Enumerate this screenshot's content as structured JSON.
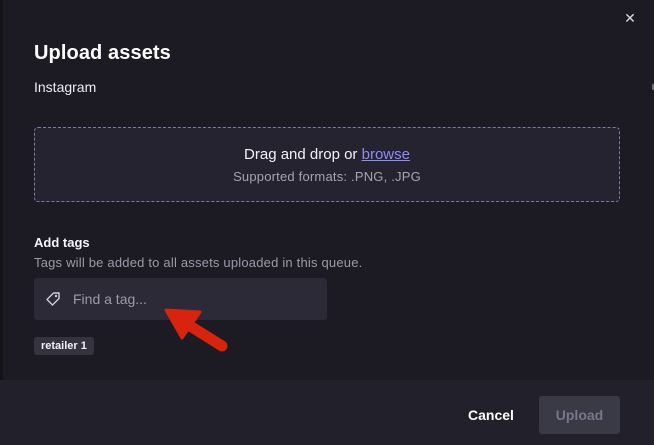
{
  "modal": {
    "title": "Upload assets",
    "subtitle": "Instagram",
    "close_icon": "close-icon"
  },
  "dropzone": {
    "prefix": "Drag and drop or ",
    "link": "browse",
    "formats": "Supported formats: .PNG, .JPG"
  },
  "tags": {
    "heading": "Add tags",
    "help": "Tags will be added to all assets uploaded in this queue.",
    "input_value": "",
    "input_placeholder": "Find a tag...",
    "input_icon": "tag-icon",
    "selected": [
      "retailer 1"
    ]
  },
  "footer": {
    "cancel_label": "Cancel",
    "upload_label": "Upload"
  },
  "colors": {
    "modal_bg": "#1c1b24",
    "accent_link": "#8e8df5",
    "annotation_arrow": "#d8240f"
  }
}
